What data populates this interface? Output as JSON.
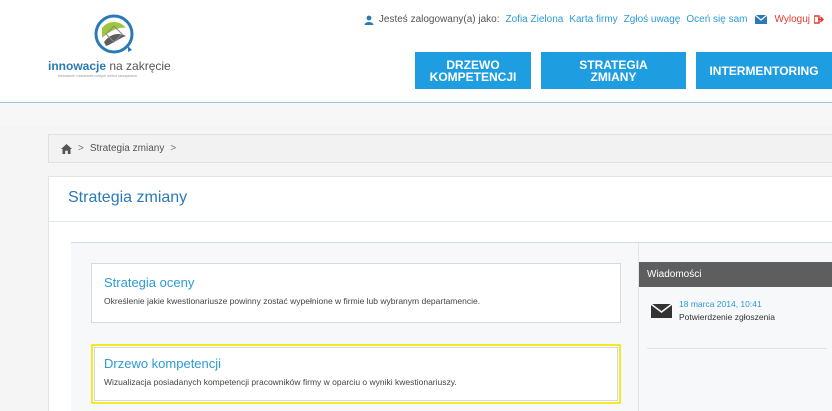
{
  "header": {
    "logo": {
      "brand_bold": "innowacje",
      "brand_rest": " na zakręcie",
      "tagline": "testowanie i wdrażanie nowych metod zarządzania"
    },
    "topbar": {
      "logged_in_text": "Jesteś zalogowany(a) jako:",
      "user_name": "Zofia Zielona",
      "links": [
        "Karta firmy",
        "Zgłoś uwagę",
        "Oceń się sam"
      ],
      "logout_label": "Wyloguj"
    },
    "nav": [
      {
        "line1": "DRZEWO",
        "line2": "KOMPETENCJI"
      },
      {
        "line1": "STRATEGIA",
        "line2": "ZMIANY"
      },
      {
        "line1": "INTERMENTORING",
        "line2": ""
      }
    ]
  },
  "breadcrumb": {
    "items": [
      "Strategia zmiany"
    ],
    "separator": ">"
  },
  "page": {
    "title": "Strategia zmiany"
  },
  "cards": [
    {
      "title": "Strategia oceny",
      "description": "Określenie jakie kwestionariusze powinny zostać wypełnione w firmie lub wybranym departamencie."
    },
    {
      "title": "Drzewo kompetencji",
      "description": "Wizualizacja posiadanych kompetencji pracowników firmy w oparciu o wyniki kwestionariuszy."
    }
  ],
  "sidebar": {
    "header": "Wiadomości",
    "messages": [
      {
        "date": "18 marca 2014, 10:41",
        "text": "Potwierdzenie zgłoszenia"
      }
    ]
  },
  "colors": {
    "accent": "#1e9ee0",
    "link": "#2d9ad6",
    "title": "#2a7ab8",
    "logout": "#e23a2e",
    "highlight": "#f5ea28",
    "sidebar_header": "#5e5e5e"
  },
  "icons": {
    "user": "user-icon",
    "mail": "mail-icon",
    "logout": "logout-icon",
    "home": "home-icon",
    "message": "envelope-icon",
    "logo": "logo-emblem-icon"
  }
}
